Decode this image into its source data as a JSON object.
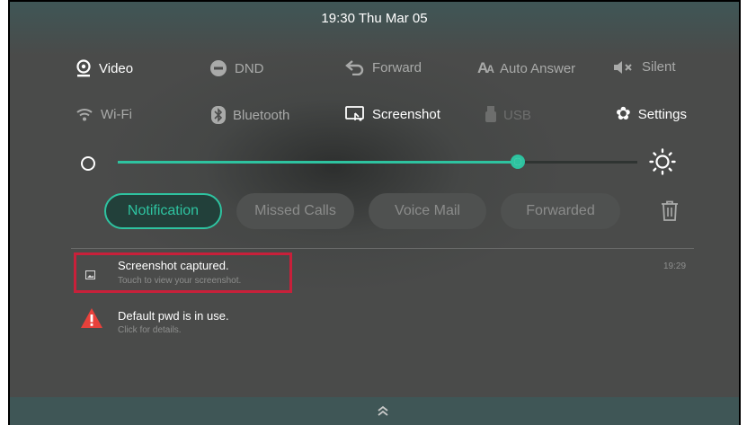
{
  "status": {
    "time": "19:30 Thu Mar 05"
  },
  "quick_settings": {
    "row1": [
      {
        "label": "Video",
        "icon": "video-icon",
        "state": "on"
      },
      {
        "label": "DND",
        "icon": "dnd-icon",
        "state": "off"
      },
      {
        "label": "Forward",
        "icon": "forward-icon",
        "state": "off"
      },
      {
        "label": "Auto Answer",
        "icon": "auto-answer-icon",
        "state": "off"
      },
      {
        "label": "Silent",
        "icon": "silent-icon",
        "state": "off"
      }
    ],
    "row2": [
      {
        "label": "Wi-Fi",
        "icon": "wifi-icon",
        "state": "off"
      },
      {
        "label": "Bluetooth",
        "icon": "bluetooth-icon",
        "state": "off"
      },
      {
        "label": "Screenshot",
        "icon": "screenshot-icon",
        "state": "on"
      },
      {
        "label": "USB",
        "icon": "usb-icon",
        "state": "dim"
      },
      {
        "label": "Settings",
        "icon": "settings-icon",
        "state": "on"
      }
    ]
  },
  "brightness": {
    "level": 0.77
  },
  "tabs": [
    {
      "label": "Notification",
      "active": true
    },
    {
      "label": "Missed Calls",
      "active": false
    },
    {
      "label": "Voice Mail",
      "active": false
    },
    {
      "label": "Forwarded",
      "active": false
    }
  ],
  "notifications": [
    {
      "title": "Screenshot captured.",
      "subtitle": "Touch to view your screenshot.",
      "time": "19:29",
      "icon": "image-icon"
    },
    {
      "title": "Default pwd is in use.",
      "subtitle": "Click for details.",
      "time": "",
      "icon": "warning-icon"
    }
  ],
  "colors": {
    "accent": "#2ec3a0",
    "highlight": "#c8203a",
    "warning": "#e8413b"
  }
}
